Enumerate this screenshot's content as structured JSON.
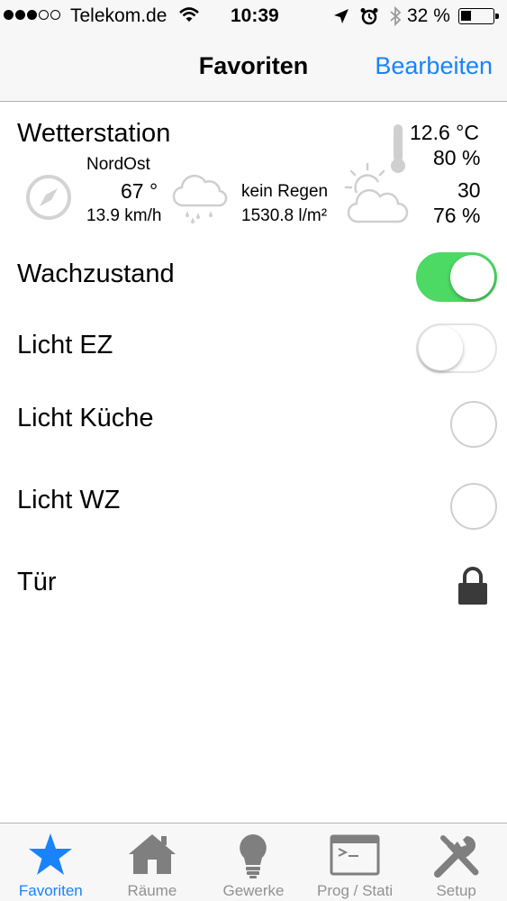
{
  "status_bar": {
    "carrier": "Telekom.de",
    "time": "10:39",
    "battery_percent": "32 %",
    "battery_level": 0.32,
    "signal_bars": 3,
    "signal_total": 5
  },
  "nav": {
    "title": "Favoriten",
    "edit_label": "Bearbeiten"
  },
  "weather": {
    "title": "Wetterstation",
    "wind_direction": "NordOst",
    "wind_degrees": "67 °",
    "wind_speed": "13.9 km/h",
    "rain_status": "kein Regen",
    "rain_amount": "1530.8 l/m²",
    "temperature": "12.6 °C",
    "humidity": "80 %",
    "brightness": "30",
    "sunshine": "76 %"
  },
  "rows": [
    {
      "label": "Wachzustand",
      "control": "toggle",
      "state": "on"
    },
    {
      "label": "Licht EZ",
      "control": "toggle",
      "state": "off"
    },
    {
      "label": "Licht Küche",
      "control": "radio",
      "state": "off"
    },
    {
      "label": "Licht WZ",
      "control": "radio",
      "state": "off"
    },
    {
      "label": "Tür",
      "control": "lock",
      "state": "locked"
    }
  ],
  "tabs": [
    {
      "label": "Favoriten",
      "icon": "star-icon",
      "active": true
    },
    {
      "label": "Räume",
      "icon": "house-icon",
      "active": false
    },
    {
      "label": "Gewerke",
      "icon": "lightbulb-icon",
      "active": false
    },
    {
      "label": "Prog / Stati",
      "icon": "terminal-icon",
      "active": false
    },
    {
      "label": "Setup",
      "icon": "tools-icon",
      "active": false
    }
  ],
  "colors": {
    "accent": "#1a82fb",
    "toggle_on": "#4cd964",
    "inactive_icon": "#7f7f7f"
  }
}
